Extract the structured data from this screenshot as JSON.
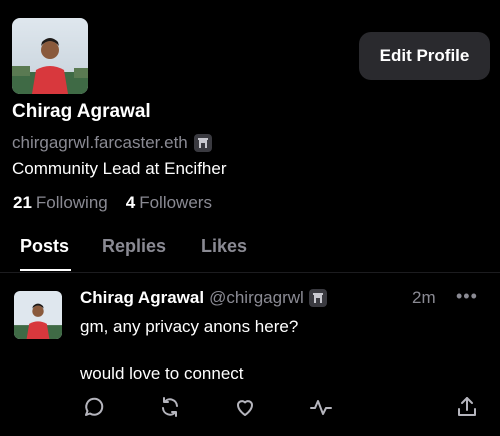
{
  "profile": {
    "name": "Chirag Agrawal",
    "handle": "chirgagrwl.farcaster.eth",
    "bio": "Community Lead at Encifher",
    "following_count": "21",
    "following_label": "Following",
    "followers_count": "4",
    "followers_label": "Followers",
    "edit_label": "Edit Profile"
  },
  "tabs": [
    {
      "label": "Posts",
      "active": true
    },
    {
      "label": "Replies",
      "active": false
    },
    {
      "label": "Likes",
      "active": false
    }
  ],
  "post": {
    "author": "Chirag Agrawal",
    "handle": "@chirgagrwl",
    "time": "2m",
    "more": "•••",
    "lines": [
      "gm, any privacy anons here?",
      "would love to connect"
    ],
    "actions": [
      "comment-icon",
      "recast-icon",
      "like-icon",
      "activity-icon",
      "share-icon"
    ]
  },
  "colors": {
    "background": "#000000",
    "muted": "#8a8a93",
    "button": "#2a2a2e"
  }
}
